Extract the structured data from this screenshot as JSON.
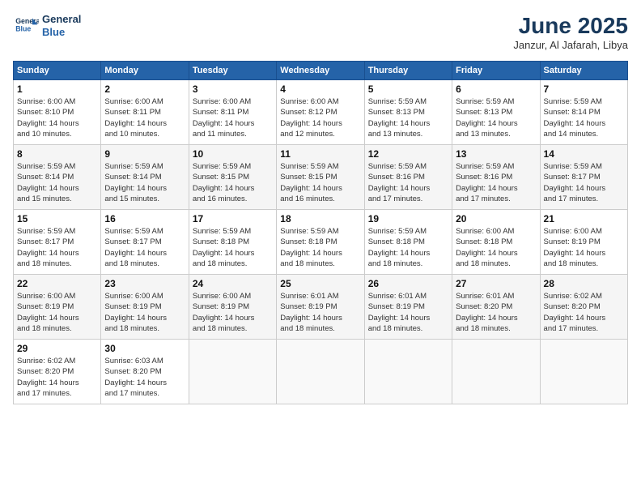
{
  "header": {
    "logo_line1": "General",
    "logo_line2": "Blue",
    "month": "June 2025",
    "location": "Janzur, Al Jafarah, Libya"
  },
  "weekdays": [
    "Sunday",
    "Monday",
    "Tuesday",
    "Wednesday",
    "Thursday",
    "Friday",
    "Saturday"
  ],
  "days": [
    {
      "date": "",
      "info": ""
    },
    {
      "date": "",
      "info": ""
    },
    {
      "date": "",
      "info": ""
    },
    {
      "date": "",
      "info": ""
    },
    {
      "date": "",
      "info": ""
    },
    {
      "date": "",
      "info": ""
    },
    {
      "date": "",
      "info": ""
    },
    {
      "date": "1",
      "info": "Sunrise: 6:00 AM\nSunset: 8:10 PM\nDaylight: 14 hours\nand 10 minutes."
    },
    {
      "date": "2",
      "info": "Sunrise: 6:00 AM\nSunset: 8:11 PM\nDaylight: 14 hours\nand 10 minutes."
    },
    {
      "date": "3",
      "info": "Sunrise: 6:00 AM\nSunset: 8:11 PM\nDaylight: 14 hours\nand 11 minutes."
    },
    {
      "date": "4",
      "info": "Sunrise: 6:00 AM\nSunset: 8:12 PM\nDaylight: 14 hours\nand 12 minutes."
    },
    {
      "date": "5",
      "info": "Sunrise: 5:59 AM\nSunset: 8:13 PM\nDaylight: 14 hours\nand 13 minutes."
    },
    {
      "date": "6",
      "info": "Sunrise: 5:59 AM\nSunset: 8:13 PM\nDaylight: 14 hours\nand 13 minutes."
    },
    {
      "date": "7",
      "info": "Sunrise: 5:59 AM\nSunset: 8:14 PM\nDaylight: 14 hours\nand 14 minutes."
    },
    {
      "date": "8",
      "info": "Sunrise: 5:59 AM\nSunset: 8:14 PM\nDaylight: 14 hours\nand 15 minutes."
    },
    {
      "date": "9",
      "info": "Sunrise: 5:59 AM\nSunset: 8:14 PM\nDaylight: 14 hours\nand 15 minutes."
    },
    {
      "date": "10",
      "info": "Sunrise: 5:59 AM\nSunset: 8:15 PM\nDaylight: 14 hours\nand 16 minutes."
    },
    {
      "date": "11",
      "info": "Sunrise: 5:59 AM\nSunset: 8:15 PM\nDaylight: 14 hours\nand 16 minutes."
    },
    {
      "date": "12",
      "info": "Sunrise: 5:59 AM\nSunset: 8:16 PM\nDaylight: 14 hours\nand 17 minutes."
    },
    {
      "date": "13",
      "info": "Sunrise: 5:59 AM\nSunset: 8:16 PM\nDaylight: 14 hours\nand 17 minutes."
    },
    {
      "date": "14",
      "info": "Sunrise: 5:59 AM\nSunset: 8:17 PM\nDaylight: 14 hours\nand 17 minutes."
    },
    {
      "date": "15",
      "info": "Sunrise: 5:59 AM\nSunset: 8:17 PM\nDaylight: 14 hours\nand 18 minutes."
    },
    {
      "date": "16",
      "info": "Sunrise: 5:59 AM\nSunset: 8:17 PM\nDaylight: 14 hours\nand 18 minutes."
    },
    {
      "date": "17",
      "info": "Sunrise: 5:59 AM\nSunset: 8:18 PM\nDaylight: 14 hours\nand 18 minutes."
    },
    {
      "date": "18",
      "info": "Sunrise: 5:59 AM\nSunset: 8:18 PM\nDaylight: 14 hours\nand 18 minutes."
    },
    {
      "date": "19",
      "info": "Sunrise: 5:59 AM\nSunset: 8:18 PM\nDaylight: 14 hours\nand 18 minutes."
    },
    {
      "date": "20",
      "info": "Sunrise: 6:00 AM\nSunset: 8:18 PM\nDaylight: 14 hours\nand 18 minutes."
    },
    {
      "date": "21",
      "info": "Sunrise: 6:00 AM\nSunset: 8:19 PM\nDaylight: 14 hours\nand 18 minutes."
    },
    {
      "date": "22",
      "info": "Sunrise: 6:00 AM\nSunset: 8:19 PM\nDaylight: 14 hours\nand 18 minutes."
    },
    {
      "date": "23",
      "info": "Sunrise: 6:00 AM\nSunset: 8:19 PM\nDaylight: 14 hours\nand 18 minutes."
    },
    {
      "date": "24",
      "info": "Sunrise: 6:00 AM\nSunset: 8:19 PM\nDaylight: 14 hours\nand 18 minutes."
    },
    {
      "date": "25",
      "info": "Sunrise: 6:01 AM\nSunset: 8:19 PM\nDaylight: 14 hours\nand 18 minutes."
    },
    {
      "date": "26",
      "info": "Sunrise: 6:01 AM\nSunset: 8:19 PM\nDaylight: 14 hours\nand 18 minutes."
    },
    {
      "date": "27",
      "info": "Sunrise: 6:01 AM\nSunset: 8:20 PM\nDaylight: 14 hours\nand 18 minutes."
    },
    {
      "date": "28",
      "info": "Sunrise: 6:02 AM\nSunset: 8:20 PM\nDaylight: 14 hours\nand 17 minutes."
    },
    {
      "date": "29",
      "info": "Sunrise: 6:02 AM\nSunset: 8:20 PM\nDaylight: 14 hours\nand 17 minutes."
    },
    {
      "date": "30",
      "info": "Sunrise: 6:03 AM\nSunset: 8:20 PM\nDaylight: 14 hours\nand 17 minutes."
    },
    {
      "date": "",
      "info": ""
    },
    {
      "date": "",
      "info": ""
    },
    {
      "date": "",
      "info": ""
    },
    {
      "date": "",
      "info": ""
    },
    {
      "date": "",
      "info": ""
    }
  ]
}
